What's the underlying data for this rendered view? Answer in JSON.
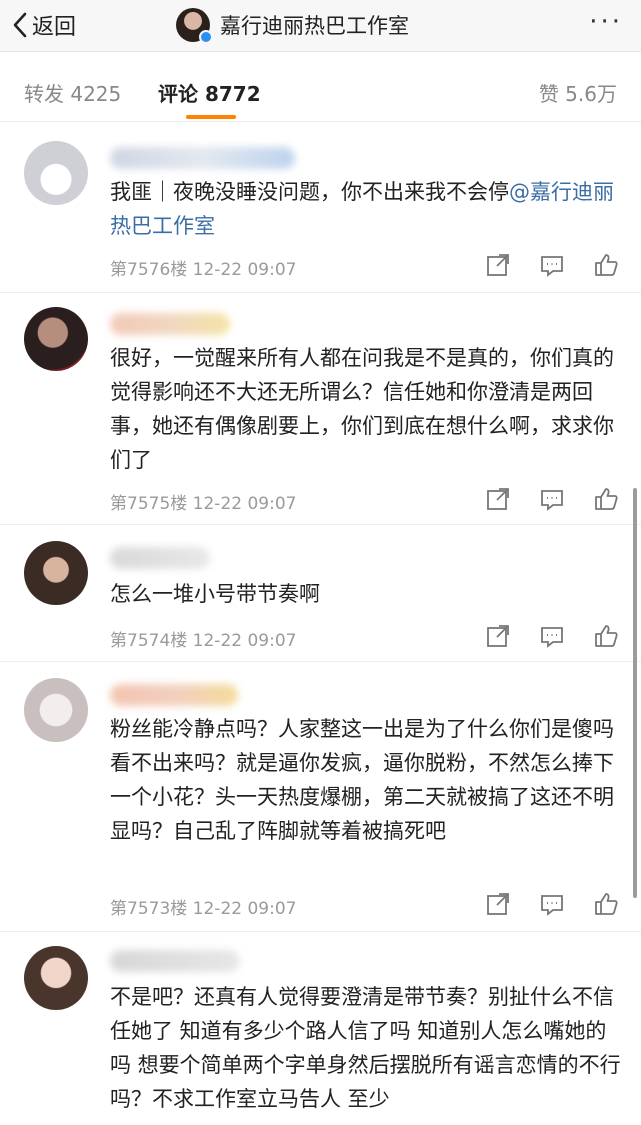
{
  "header": {
    "back_label": "返回",
    "title": "嘉行迪丽热巴工作室"
  },
  "tabs": [
    {
      "label": "转发 4225"
    },
    {
      "label": "评论 8772"
    },
    {
      "label": "赞 5.6万"
    }
  ],
  "comments": [
    {
      "text_parts": [
        "我匪｜夜晚没睡没问题，你不出来我不会停",
        "@嘉行迪丽热巴工作室"
      ],
      "floor": "第7576楼",
      "time": "12-22 09:07"
    },
    {
      "text": "很好，一觉醒来所有人都在问我是不是真的，你们真的觉得影响还不大还无所谓么？信任她和你澄清是两回事，她还有偶像剧要上，你们到底在想什么啊，求求你们了",
      "floor": "第7575楼",
      "time": "12-22 09:07"
    },
    {
      "text": "怎么一堆小号带节奏啊",
      "floor": "第7574楼",
      "time": "12-22 09:07"
    },
    {
      "text": "粉丝能冷静点吗？人家整这一出是为了什么你们是傻吗看不出来吗？就是逼你发疯，逼你脱粉，不然怎么捧下一个小花？头一天热度爆棚，第二天就被搞了这还不明显吗？自己乱了阵脚就等着被搞死吧",
      "floor": "第7573楼",
      "time": "12-22 09:07"
    },
    {
      "text": "不是吧？还真有人觉得要澄清是带节奏？别扯什么不信任她了 知道有多少个路人信了吗 知道别人怎么嘴她的吗 想要个简单两个字单身然后摆脱所有谣言恋情的不行吗？不求工作室立马告人 至少",
      "floor": "",
      "time": ""
    }
  ],
  "colors": {
    "accent": "#ff8200",
    "mention": "#3b6ea5",
    "meta": "#9a9a9a"
  },
  "icons": [
    "back-chevron-icon",
    "more-dots-icon",
    "share-icon",
    "comment-icon",
    "like-icon",
    "verified-badge-icon"
  ]
}
